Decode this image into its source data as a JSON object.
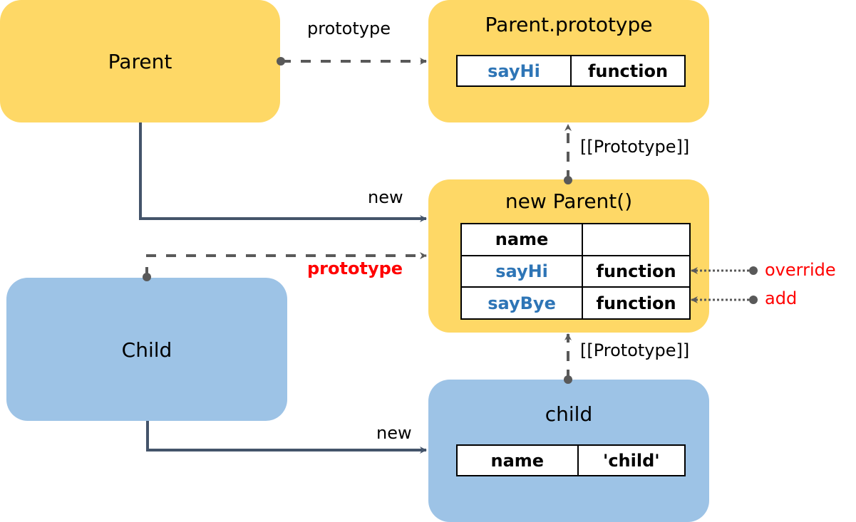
{
  "nodes": {
    "parent": {
      "title": "Parent"
    },
    "parent_prototype": {
      "title": "Parent.prototype",
      "rows": [
        {
          "key": "sayHi",
          "value": "function"
        }
      ]
    },
    "new_parent": {
      "title": "new Parent()",
      "rows": [
        {
          "key": "name",
          "value": ""
        },
        {
          "key": "sayHi",
          "value": "function"
        },
        {
          "key": "sayBye",
          "value": "function"
        }
      ]
    },
    "child_ctor": {
      "title": "Child"
    },
    "child_instance": {
      "title": "child",
      "rows": [
        {
          "key": "name",
          "value": "'child'"
        }
      ]
    }
  },
  "edges": {
    "parent_prototype_label": "prototype",
    "proto_link_upper_label": "[[Prototype]]",
    "parent_new_label": "new",
    "child_prototype_label": "prototype",
    "proto_link_lower_label": "[[Prototype]]",
    "child_new_label": "new",
    "override_label": "override",
    "add_label": "add"
  },
  "colors": {
    "parent_fill": "#fed866",
    "child_fill": "#9dc3e6",
    "key_text": "#2e75b6",
    "annotation_red": "#ff0000",
    "solid_arrow": "#44546a",
    "dashed_arrow": "#595959"
  }
}
